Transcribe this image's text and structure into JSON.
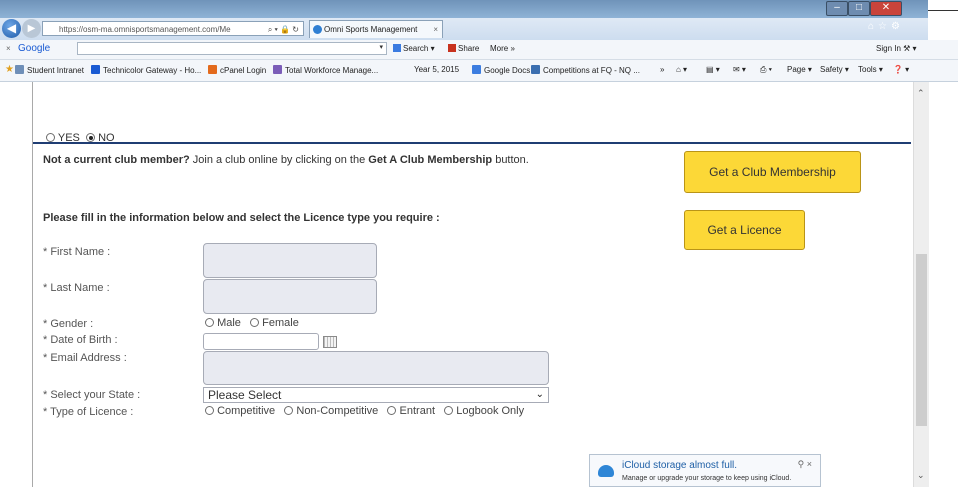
{
  "browser": {
    "address": "https://osm-ma.omnisportsmanagement.com/Me",
    "tab_title": "Omni Sports Management",
    "tab_close": "×"
  },
  "google_bar": {
    "close": "×",
    "logo": "Google",
    "search_label": "Search ▾",
    "share_label": "Share",
    "more_label": "More »",
    "signin_label": "Sign In"
  },
  "favorites": [
    {
      "label": "Student Intranet",
      "color": "#6f8fb8"
    },
    {
      "label": "Technicolor Gateway - Ho...",
      "color": "#1a5bd3"
    },
    {
      "label": "cPanel Login",
      "color": "#e36a1c"
    },
    {
      "label": "Total Workforce Manage...",
      "color": "#7b5db8"
    },
    {
      "label": "Year 5, 2015",
      "color": "#ffffff"
    },
    {
      "label": "Google Docs",
      "color": "#3c7de0"
    },
    {
      "label": "Competitions at FQ - NQ ...",
      "color": "#3b6fb0"
    }
  ],
  "cmd_bar": {
    "page": "Page ▾",
    "safety": "Safety ▾",
    "tools": "Tools ▾"
  },
  "form": {
    "yes_label": "YES",
    "no_label": "NO",
    "not_member_bold": "Not a current club member?",
    "not_member_text": " Join a club online by clicking on the ",
    "not_member_button_ref": "Get A Club Membership",
    "not_member_suffix": " button.",
    "club_button": "Get a Club Membership",
    "licence_button": "Get a Licence",
    "fill_info": "Please fill in the information below and select the Licence type you require :",
    "first_name_label": "* First Name :",
    "last_name_label": "* Last Name :",
    "gender_label": "* Gender :",
    "gender_options": [
      "Male",
      "Female"
    ],
    "dob_label": "* Date of Birth :",
    "email_label": "* Email Address :",
    "state_label": "* Select your State :",
    "state_value": "Please Select",
    "licence_label": "* Type of Licence :",
    "licence_options": [
      "Competitive",
      "Non-Competitive",
      "Entrant",
      "Logbook Only"
    ]
  },
  "notification": {
    "title": "iCloud storage almost full.",
    "body": "Manage or upgrade your storage to keep using iCloud.",
    "controls": "⚲  ×"
  },
  "colors": {
    "accent_yellow": "#fcd837",
    "divider_navy": "#1f3d73"
  }
}
